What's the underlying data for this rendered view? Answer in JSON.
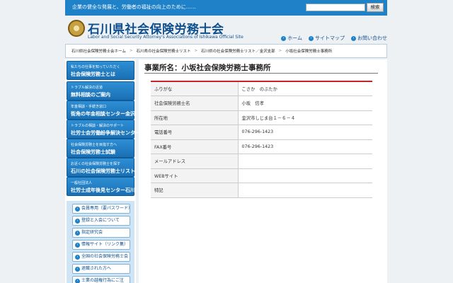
{
  "topbar": {
    "tagline": "企業の健全な発展と、労働者の福祉の向上のために……",
    "search_button": "検索",
    "search_placeholder": ""
  },
  "header": {
    "title": "石川県社会保険労務士会",
    "subtitle": "Labor and Social Security Attorney's Associations of Ishikawa Official Site",
    "links": [
      {
        "label": "ホーム",
        "icon": "arrow-right-icon"
      },
      {
        "label": "サイトマップ",
        "icon": "arrow-right-icon"
      },
      {
        "label": "お問い合わせ",
        "icon": "arrow-right-icon"
      }
    ]
  },
  "breadcrumb": [
    "石川県社会保険労務士会ホーム",
    "石川県の社会保険労務士リスト",
    "石川県の社会保険労務士リスト／金沢支部",
    "小坂社会保険労務士事務所"
  ],
  "sidebar": {
    "banners": [
      {
        "small": "私たちの仕事を知っていただく",
        "big": "社会保険労務士とは"
      },
      {
        "small": "トラブル解決の近道",
        "big": "無料相談のご案内"
      },
      {
        "small": "年金相談・手続き窓口",
        "big": "街角の年金相談センター金沢"
      },
      {
        "small": "トラブルの相談・解決のサポート",
        "big": "社労士会労働紛争解決センター石川"
      },
      {
        "small": "社会保険労務士を目指す方へ",
        "big": "社会保険労務士試験"
      },
      {
        "small": "お近くの社会保険労務士を探す",
        "big": "石川の社会保険労務士リスト"
      },
      {
        "small": "一般社団法人",
        "big": "社労士成年後見センター石川"
      }
    ],
    "buttons": [
      "会員専用（要パスワード）",
      "登録と入会について",
      "指定研究会",
      "情報サイト（リンク集）",
      "全国の社会保険労務士会",
      "退職された方へ",
      "士業の越権行為にご注"
    ]
  },
  "main": {
    "heading": "事業所名：小坂社会保険労務士事務所",
    "rows": [
      {
        "label": "ふりがな",
        "value": "こさか　のぶたか"
      },
      {
        "label": "社会保険労務士名",
        "value": "小坂　信孝"
      },
      {
        "label": "所在地",
        "value": "金沢市しじま台１－６－４"
      },
      {
        "label": "電話番号",
        "value": "076-296-1423"
      },
      {
        "label": "FAX番号",
        "value": "076-296-1423"
      },
      {
        "label": "メールアドレス",
        "value": ""
      },
      {
        "label": "WEBサイト",
        "value": ""
      },
      {
        "label": "特記",
        "value": ""
      }
    ]
  },
  "colors": {
    "topbar": "#1f82c8",
    "title": "#0e4f8e",
    "accent_rule": "#c8232c",
    "sidebar_box": "#cfe5f5"
  }
}
